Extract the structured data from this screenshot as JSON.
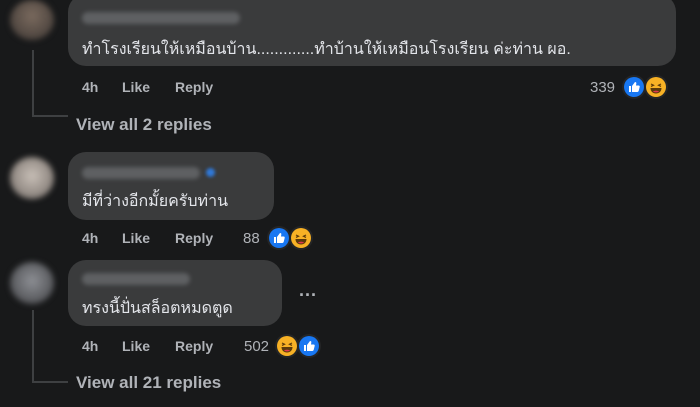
{
  "colors": {
    "background": "#18191a",
    "bubble": "#3a3b3c",
    "like_blue": "#1877f2",
    "haha_yellow": "#f7b125"
  },
  "comments": [
    {
      "text": "ทำโรงเรียนให้เหมือนบ้าน.............ทำบ้านให้เหมือนโรงเรียน ค่ะท่าน ผอ.",
      "time": "4h",
      "like": "Like",
      "reply": "Reply",
      "reaction_count": "339",
      "reactions": [
        "like-icon",
        "haha-icon"
      ]
    },
    {
      "text": "มีที่ว่างอีกมั้ยครับท่าน",
      "time": "4h",
      "like": "Like",
      "reply": "Reply",
      "reaction_count": "88",
      "reactions": [
        "like-icon",
        "haha-icon"
      ]
    },
    {
      "text": "ทรงนี้ปั่นสล็อตหมดตูด",
      "time": "4h",
      "like": "Like",
      "reply": "Reply",
      "reaction_count": "502",
      "reactions": [
        "haha-icon",
        "like-icon"
      ]
    }
  ],
  "view_replies": [
    "View all 2 replies",
    "View all 21 replies"
  ],
  "more_options": "..."
}
